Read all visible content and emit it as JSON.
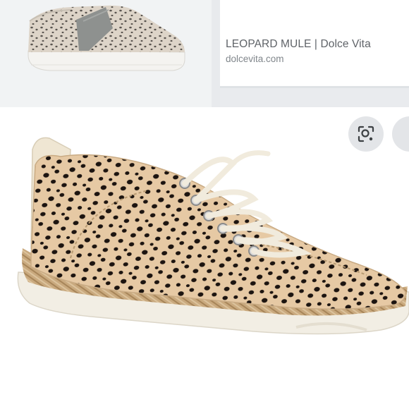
{
  "result": {
    "title": "LEOPARD MULE | Dolce Vita",
    "domain": "dolcevita.com"
  },
  "icons": {
    "lens": "lens-search-icon"
  },
  "colors": {
    "print_base": "#e6c9a4",
    "print_spot": "#1c1410",
    "sole": "#f3efe6",
    "jute": "#c7a77c"
  }
}
